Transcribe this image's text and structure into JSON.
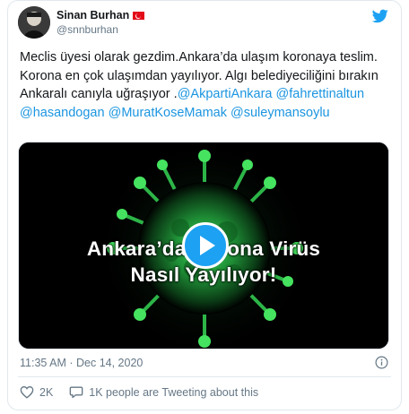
{
  "tweet": {
    "author": {
      "display_name": "Sinan Burhan",
      "handle": "@snnburhan"
    },
    "text_plain": "Meclis üyesi olarak gezdim.Ankara’da ulaşım koronaya teslim. Korona en çok ulaşımdan yayılıyor. Algı belediyeciliğini bırakın Ankaralı canıyla uğraşıyor .",
    "mentions": [
      "@AkpartiAnkara",
      "@fahrettinaltun",
      "@hasandogan",
      "@MuratKoseMamak",
      "@suleymansoylu"
    ],
    "video": {
      "title_line1": "Ankara’da Korona Virüs",
      "title_line2": "Nasıl Yayılıyor!"
    },
    "timestamp": "11:35 AM · Dec 14, 2020",
    "likes": "2K",
    "conversation": "1K people are Tweeting about this"
  },
  "colors": {
    "link": "#1b95e0",
    "twitter_blue": "#1da1f2",
    "like_red": "#e0245e",
    "secondary_text": "#657786"
  },
  "icons": {
    "brand": "twitter-bird-icon",
    "like": "heart-icon",
    "reply": "speech-bubble-icon",
    "info": "info-icon",
    "play": "play-icon"
  }
}
